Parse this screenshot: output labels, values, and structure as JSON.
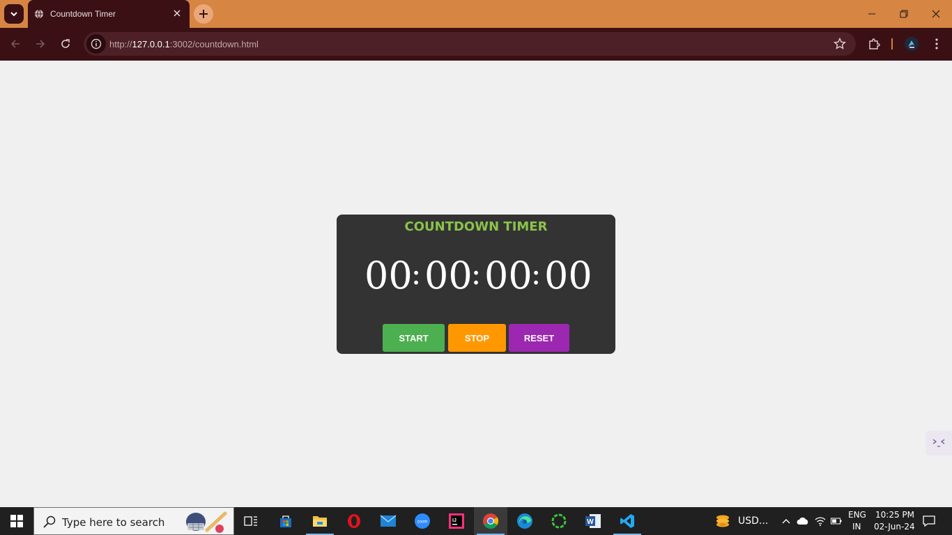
{
  "browser": {
    "tab_title": "Countdown Timer",
    "url_prefix": "http://",
    "url_host": "127.0.0.1",
    "url_rest": ":3002/countdown.html"
  },
  "timer": {
    "title": "COUNTDOWN TIMER",
    "days": "00",
    "hours": "00",
    "minutes": "00",
    "seconds": "00",
    "separator": ":",
    "start_label": "START",
    "stop_label": "STOP",
    "reset_label": "RESET"
  },
  "taskbar": {
    "search_placeholder": "Type here to search",
    "weather_text": "USD...",
    "language_top": "ENG",
    "language_bottom": "IN",
    "time": "10:25 PM",
    "date": "02-Jun-24",
    "apps": [
      "task-view",
      "microsoft-store",
      "file-explorer",
      "opera",
      "mail",
      "zoom",
      "intellij",
      "chrome",
      "edge",
      "app-green-ring",
      "word",
      "vscode"
    ]
  },
  "colors": {
    "title_bar": "#d68543",
    "toolbar": "#3a1015",
    "page_bg": "#f0f0f0",
    "card_bg": "#333333",
    "title_green": "#8bc34a",
    "start": "#4caf50",
    "stop": "#ff9800",
    "reset": "#9c27b0"
  }
}
